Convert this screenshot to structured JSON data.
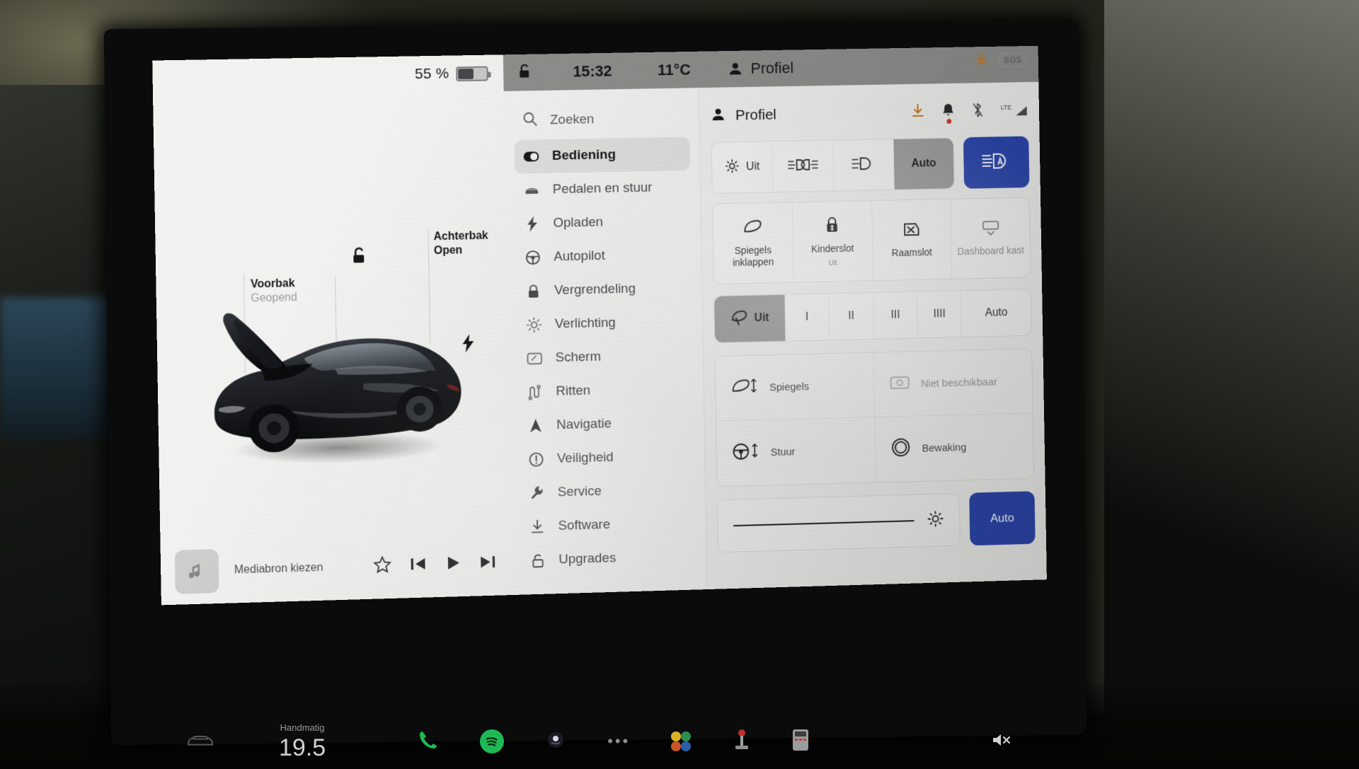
{
  "statusbar": {
    "battery_pct": "55 %",
    "lock_icon": "unlock-icon",
    "clock": "15:32",
    "temperature": "11°C",
    "profile_label": "Profiel",
    "sos_label": "SOS"
  },
  "car_view": {
    "front_trunk": {
      "title": "Voorbak",
      "state": "Geopend"
    },
    "rear_trunk": {
      "title": "Achterbak",
      "state": "Open"
    }
  },
  "media": {
    "source_label": "Mediabron kiezen",
    "icons": [
      "music-note-icon",
      "star-icon",
      "previous-track-icon",
      "play-icon",
      "next-track-icon"
    ]
  },
  "sidebar": {
    "search_placeholder": "Zoeken",
    "items": [
      {
        "label": "Bediening",
        "icon": "toggle-icon",
        "active": true
      },
      {
        "label": "Pedalen en stuur",
        "icon": "car-front-icon",
        "active": false
      },
      {
        "label": "Opladen",
        "icon": "bolt-icon",
        "active": false
      },
      {
        "label": "Autopilot",
        "icon": "steering-wheel-icon",
        "active": false
      },
      {
        "label": "Vergrendeling",
        "icon": "lock-icon",
        "active": false
      },
      {
        "label": "Verlichting",
        "icon": "sun-icon",
        "active": false
      },
      {
        "label": "Scherm",
        "icon": "display-icon",
        "active": false
      },
      {
        "label": "Ritten",
        "icon": "trips-icon",
        "active": false
      },
      {
        "label": "Navigatie",
        "icon": "navigation-arrow-icon",
        "active": false
      },
      {
        "label": "Veiligheid",
        "icon": "warning-circle-icon",
        "active": false
      },
      {
        "label": "Service",
        "icon": "wrench-icon",
        "active": false
      },
      {
        "label": "Software",
        "icon": "download-icon",
        "active": false
      },
      {
        "label": "Upgrades",
        "icon": "unlock-shop-icon",
        "active": false
      }
    ]
  },
  "controls": {
    "header_title": "Profiel",
    "header_icons": [
      "download-icon",
      "bell-icon",
      "bluetooth-off-icon",
      "lte-signal-icon"
    ],
    "header_lte_label": "LTE",
    "lights": {
      "options": [
        {
          "label": "Uit",
          "icon": "headlight-off-icon",
          "selected": false
        },
        {
          "label": "",
          "icon": "parking-lights-icon",
          "selected": false
        },
        {
          "label": "",
          "icon": "low-beam-icon",
          "selected": false
        },
        {
          "label": "Auto",
          "icon": "",
          "selected": true
        }
      ],
      "high_beam_auto": {
        "icon": "auto-high-beam-icon",
        "accent": "#2c47ad"
      }
    },
    "tiles": [
      {
        "label": "Spiegels inklappen",
        "sub": "",
        "icon": "mirror-fold-icon",
        "disabled": false
      },
      {
        "label": "Kinderslot",
        "sub": "Uit",
        "icon": "child-lock-icon",
        "disabled": false
      },
      {
        "label": "Raamslot",
        "sub": "",
        "icon": "window-lock-icon",
        "disabled": false
      },
      {
        "label": "Dashboard kast",
        "sub": "",
        "icon": "glovebox-icon",
        "disabled": true
      }
    ],
    "wipers": {
      "options": [
        {
          "label": "Uit",
          "icon": "wiper-icon",
          "selected": true
        },
        {
          "label": "I",
          "icon": "",
          "selected": false
        },
        {
          "label": "II",
          "icon": "",
          "selected": false
        },
        {
          "label": "III",
          "icon": "",
          "selected": false
        },
        {
          "label": "IIII",
          "icon": "",
          "selected": false
        },
        {
          "label": "Auto",
          "icon": "",
          "selected": false
        }
      ]
    },
    "quad": [
      {
        "label": "Spiegels",
        "icon": "mirror-adjust-icon",
        "disabled": false
      },
      {
        "label": "Niet beschikbaar",
        "icon": "dashcam-icon",
        "disabled": true
      },
      {
        "label": "Stuur",
        "icon": "steering-adjust-icon",
        "disabled": false
      },
      {
        "label": "Bewaking",
        "icon": "sentry-mode-icon",
        "disabled": false
      }
    ],
    "brightness": {
      "value_pct": 97,
      "icon": "brightness-icon",
      "auto_label": "Auto",
      "accent": "#2c47ad"
    }
  },
  "dock": {
    "car_icon": "car-icon",
    "climate_mode": "Handmatig",
    "climate_temp": "19.5",
    "apps": [
      "phone-icon",
      "spotify-icon",
      "voice-icon",
      "more-dots-icon",
      "toybox-icon",
      "arcade-icon",
      "calculator-icon"
    ],
    "mute_icon": "mute-icon",
    "close_icon": "close-icon"
  }
}
